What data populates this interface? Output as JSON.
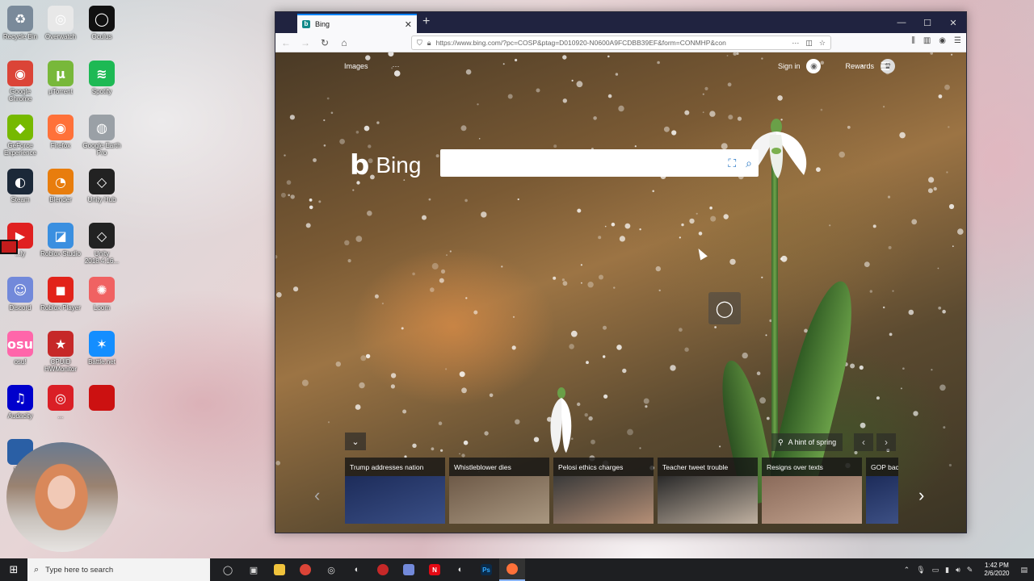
{
  "desktop": {
    "icons": [
      {
        "label": "Recycle Bin",
        "glyph": "♻",
        "color": "#7a8a9a"
      },
      {
        "label": "Overwatch",
        "glyph": "◎",
        "color": "#e8e8e8"
      },
      {
        "label": "Oculus",
        "glyph": "◯",
        "color": "#111111"
      },
      {
        "label": "Google Chrome",
        "glyph": "◉",
        "color": "#db4437"
      },
      {
        "label": "µTorrent",
        "glyph": "µ",
        "color": "#78b83a"
      },
      {
        "label": "Spotify",
        "glyph": "≋",
        "color": "#1db954"
      },
      {
        "label": "GeForce Experience",
        "glyph": "◆",
        "color": "#76b900"
      },
      {
        "label": "Firefox",
        "glyph": "◉",
        "color": "#ff7139"
      },
      {
        "label": "Google Earth Pro",
        "glyph": "◍",
        "color": "#9aa0a6"
      },
      {
        "label": "Steam",
        "glyph": "◐",
        "color": "#1b2838"
      },
      {
        "label": "Blender",
        "glyph": "◔",
        "color": "#e87d0d"
      },
      {
        "label": "Unity Hub",
        "glyph": "◇",
        "color": "#222222"
      },
      {
        "label": "...ly",
        "glyph": "▶",
        "color": "#e02020"
      },
      {
        "label": "Roblox Studio",
        "glyph": "◪",
        "color": "#3a8fe0"
      },
      {
        "label": "Unity 2018.4.16...",
        "glyph": "◇",
        "color": "#222222"
      },
      {
        "label": "Discord",
        "glyph": "☺",
        "color": "#7289da"
      },
      {
        "label": "Roblox Player",
        "glyph": "◼",
        "color": "#e2231a"
      },
      {
        "label": "Loom",
        "glyph": "✺",
        "color": "#f06262"
      },
      {
        "label": "osu!",
        "glyph": "osu",
        "color": "#ff66aa"
      },
      {
        "label": "CPUID HWMonitor",
        "glyph": "★",
        "color": "#c62828"
      },
      {
        "label": "Battle.net",
        "glyph": "✶",
        "color": "#148eff"
      },
      {
        "label": "Audacity",
        "glyph": "♫",
        "color": "#0000cc"
      },
      {
        "label": "...",
        "glyph": "◎",
        "color": "#da1f26"
      },
      {
        "label": "",
        "glyph": "",
        "color": "#cc1111"
      },
      {
        "label": "Mi...",
        "glyph": "",
        "color": "#2a5fa5"
      }
    ]
  },
  "browser": {
    "tab_title": "Bing",
    "tab_favicon": "b",
    "new_tab": "+",
    "url": "https://www.bing.com/?pc=COSP&ptag=D010920-N0600A9FCDBB39EF&form=CONMHP&con",
    "window_controls": {
      "minimize": "—",
      "maximize": "☐",
      "close": "✕"
    }
  },
  "bing": {
    "top_links": [
      "Images",
      "···"
    ],
    "sign_in": "Sign in",
    "rewards": "Rewards",
    "logo_text": "Bing",
    "search_placeholder": "",
    "image_info": "A hint of spring",
    "news": [
      {
        "headline": "Trump addresses nation",
        "colors": [
          "#1d2c5a",
          "#3a4f86"
        ]
      },
      {
        "headline": "Whistleblower dies",
        "colors": [
          "#6e5a48",
          "#a99780"
        ]
      },
      {
        "headline": "Pelosi ethics charges",
        "colors": [
          "#3a3a3a",
          "#b58f76"
        ]
      },
      {
        "headline": "Teacher tweet trouble",
        "colors": [
          "#2a2a2a",
          "#bfb0a0"
        ]
      },
      {
        "headline": "Resigns over texts",
        "colors": [
          "#8a6a5a",
          "#c4a48f"
        ]
      },
      {
        "headline": "GOP bac",
        "colors": [
          "#1d2c5a",
          "#4a5f96"
        ]
      }
    ]
  },
  "taskbar": {
    "search_placeholder": "Type here to search",
    "time": "1:42 PM",
    "date": "2/6/2020"
  }
}
